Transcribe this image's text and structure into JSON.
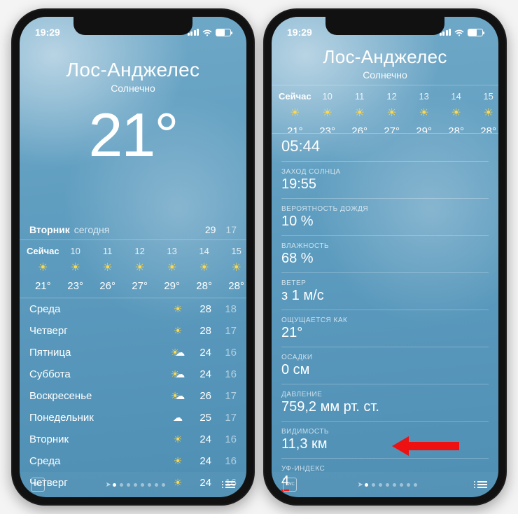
{
  "status": {
    "time": "19:29"
  },
  "left": {
    "city": "Лос-Анджелес",
    "condition": "Солнечно",
    "temp": "21°",
    "today": {
      "day": "Вторник",
      "label": "сегодня",
      "hi": "29",
      "lo": "17"
    },
    "hourly": {
      "now_label": "Сейчас",
      "cells": [
        {
          "label": "Сейчас",
          "temp": "21°"
        },
        {
          "label": "10",
          "temp": "23°"
        },
        {
          "label": "11",
          "temp": "26°"
        },
        {
          "label": "12",
          "temp": "27°"
        },
        {
          "label": "13",
          "temp": "29°"
        },
        {
          "label": "14",
          "temp": "28°"
        },
        {
          "label": "15",
          "temp": "28°"
        }
      ]
    },
    "daily": [
      {
        "day": "Среда",
        "icon": "sun",
        "hi": "28",
        "lo": "18"
      },
      {
        "day": "Четверг",
        "icon": "sun",
        "hi": "28",
        "lo": "17"
      },
      {
        "day": "Пятница",
        "icon": "partly",
        "hi": "24",
        "lo": "16"
      },
      {
        "day": "Суббота",
        "icon": "partly",
        "hi": "24",
        "lo": "16"
      },
      {
        "day": "Воскресенье",
        "icon": "partly",
        "hi": "26",
        "lo": "17"
      },
      {
        "day": "Понедельник",
        "icon": "cloud",
        "hi": "25",
        "lo": "17"
      },
      {
        "day": "Вторник",
        "icon": "sun",
        "hi": "24",
        "lo": "16"
      },
      {
        "day": "Среда",
        "icon": "sun",
        "hi": "24",
        "lo": "16"
      },
      {
        "day": "Четверг",
        "icon": "sun",
        "hi": "24",
        "lo": "16"
      }
    ]
  },
  "right": {
    "city": "Лос-Анджелес",
    "condition": "Солнечно",
    "hourly": {
      "now_label": "Сейчас",
      "cells": [
        {
          "label": "Сейчас",
          "temp": "21°"
        },
        {
          "label": "10",
          "temp": "23°"
        },
        {
          "label": "11",
          "temp": "26°"
        },
        {
          "label": "12",
          "temp": "27°"
        },
        {
          "label": "13",
          "temp": "29°"
        },
        {
          "label": "14",
          "temp": "28°"
        },
        {
          "label": "15",
          "temp": "28°"
        }
      ]
    },
    "details": {
      "sunrise": {
        "value": "05:44"
      },
      "sunset": {
        "label": "ЗАХОД СОЛНЦА",
        "value": "19:55"
      },
      "rain": {
        "label": "ВЕРОЯТНОСТЬ ДОЖДЯ",
        "value": "10 %"
      },
      "humidity": {
        "label": "ВЛАЖНОСТЬ",
        "value": "68 %"
      },
      "wind": {
        "label": "ВЕТЕР",
        "value": "з 1 м/с"
      },
      "feels": {
        "label": "ОЩУЩАЕТСЯ КАК",
        "value": "21°"
      },
      "precip": {
        "label": "ОСАДКИ",
        "value": "0 см"
      },
      "pressure": {
        "label": "ДАВЛЕНИЕ",
        "value": "759,2 мм рт. ст."
      },
      "visibility": {
        "label": "ВИДИМОСТЬ",
        "value": "11,3 км"
      },
      "uv": {
        "label": "УФ-ИНДЕКС",
        "value": "4"
      }
    }
  },
  "pager": {
    "pages": 8,
    "active": 0
  }
}
